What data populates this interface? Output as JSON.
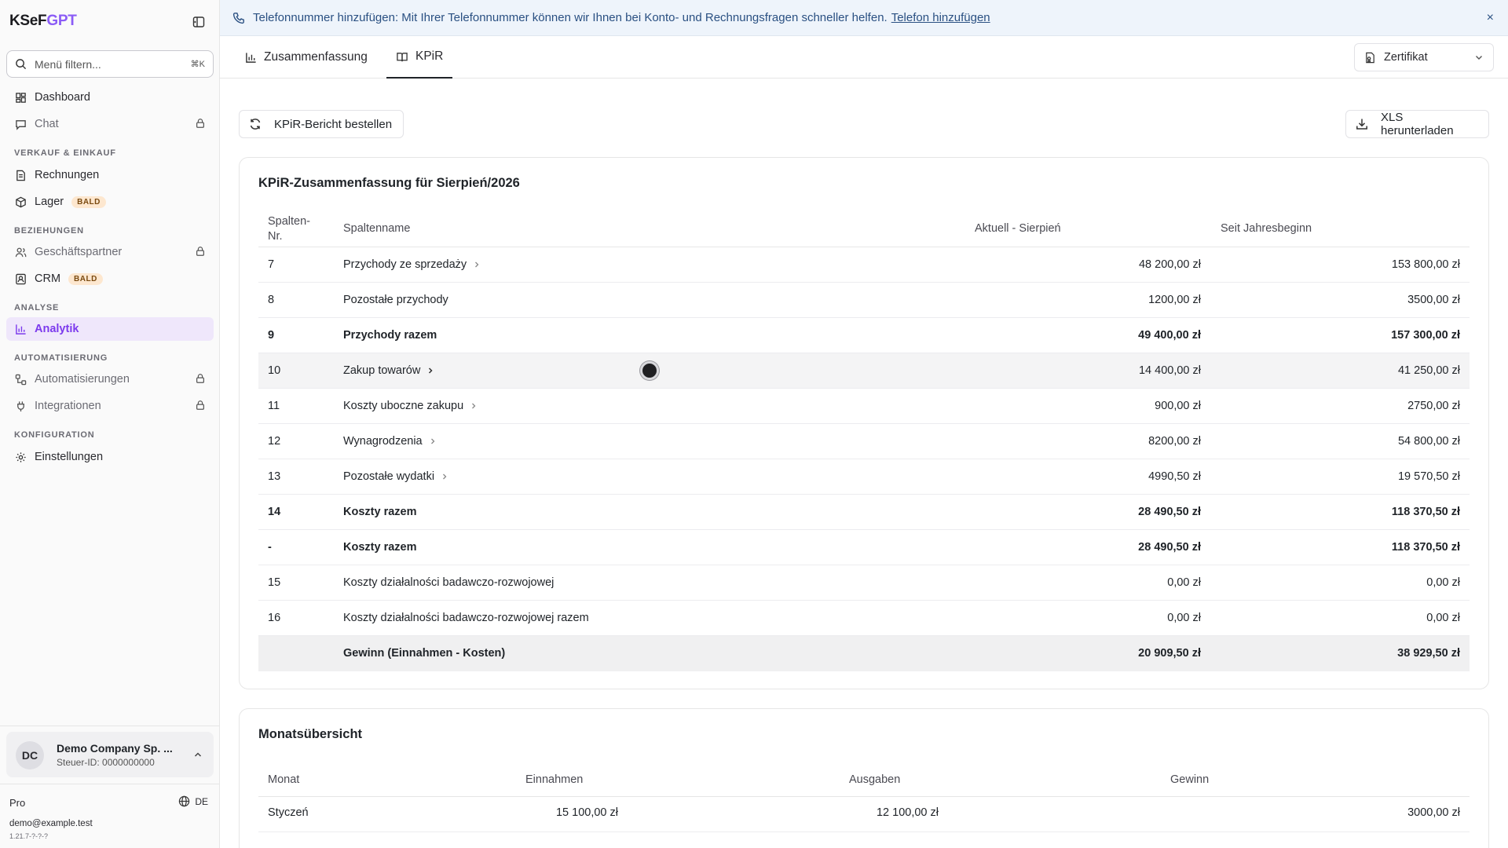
{
  "brand": {
    "prefix": "KSeF",
    "accent": "GPT"
  },
  "sidebar": {
    "filter_placeholder": "Menü filtern...",
    "filter_shortcut": "⌘K",
    "items": [
      {
        "label": "Dashboard"
      },
      {
        "label": "Chat"
      },
      {
        "label": "Rechnungen"
      },
      {
        "label": "Lager",
        "badge": "BALD"
      },
      {
        "label": "Geschäftspartner"
      },
      {
        "label": "CRM",
        "badge": "BALD"
      },
      {
        "label": "Analytik"
      },
      {
        "label": "Automatisierungen"
      },
      {
        "label": "Integrationen"
      },
      {
        "label": "Einstellungen"
      }
    ],
    "sections": [
      "VERKAUF & EINKAUF",
      "BEZIEHUNGEN",
      "ANALYSE",
      "AUTOMATISIERUNG",
      "KONFIGURATION"
    ],
    "account": {
      "initials": "DC",
      "name": "Demo Company Sp. ...",
      "tax_id": "Steuer-ID: 0000000000"
    },
    "plan": "Pro",
    "language": "DE",
    "email": "demo@example.test",
    "version": "1.21.7-?-?-?"
  },
  "banner": {
    "text": "Telefonnummer hinzufügen: Mit Ihrer Telefonnummer können wir Ihnen bei Konto- und Rechnungsfragen schneller helfen.",
    "link": "Telefon hinzufügen",
    "close": "×"
  },
  "tabs": [
    {
      "label": "Zusammenfassung"
    },
    {
      "label": "KPiR"
    }
  ],
  "certificate": {
    "label": "Zertifikat"
  },
  "actions": {
    "order_report": "KPiR-Bericht bestellen",
    "download_xls": "XLS herunterladen"
  },
  "kpir": {
    "title": "KPiR-Zusammenfassung für Sierpień/2026",
    "headers": {
      "nr_line1": "Spalten-",
      "nr_line2": "Nr.",
      "name": "Spaltenname",
      "current": "Aktuell - Sierpień",
      "ytd": "Seit Jahresbeginn"
    },
    "rows": [
      {
        "nr": "7",
        "name": "Przychody ze sprzedaży",
        "current": "48 200,00 zł",
        "ytd": "153 800,00 zł"
      },
      {
        "nr": "8",
        "name": "Pozostałe przychody",
        "current": "1200,00 zł",
        "ytd": "3500,00 zł"
      },
      {
        "nr": "9",
        "name": "Przychody razem",
        "current": "49 400,00 zł",
        "ytd": "157 300,00 zł"
      },
      {
        "nr": "10",
        "name": "Zakup towarów",
        "current": "14 400,00 zł",
        "ytd": "41 250,00 zł"
      },
      {
        "nr": "11",
        "name": "Koszty uboczne zakupu",
        "current": "900,00 zł",
        "ytd": "2750,00 zł"
      },
      {
        "nr": "12",
        "name": "Wynagrodzenia",
        "current": "8200,00 zł",
        "ytd": "54 800,00 zł"
      },
      {
        "nr": "13",
        "name": "Pozostałe wydatki",
        "current": "4990,50 zł",
        "ytd": "19 570,50 zł"
      },
      {
        "nr": "14",
        "name": "Koszty razem",
        "current": "28 490,50 zł",
        "ytd": "118 370,50 zł"
      },
      {
        "nr": "-",
        "name": "Koszty razem",
        "current": "28 490,50 zł",
        "ytd": "118 370,50 zł"
      },
      {
        "nr": "15",
        "name": "Koszty działalności badawczo-rozwojowej",
        "current": "0,00 zł",
        "ytd": "0,00 zł"
      },
      {
        "nr": "16",
        "name": "Koszty działalności badawczo-rozwojowej razem",
        "current": "0,00 zł",
        "ytd": "0,00 zł"
      },
      {
        "nr": "",
        "name": "Gewinn (Einnahmen - Kosten)",
        "current": "20 909,50 zł",
        "ytd": "38 929,50 zł"
      }
    ]
  },
  "monthly": {
    "title": "Monatsübersicht",
    "headers": {
      "month": "Monat",
      "income": "Einnahmen",
      "expenses": "Ausgaben",
      "profit": "Gewinn"
    },
    "rows": [
      {
        "month": "Styczeń",
        "income": "15 100,00 zł",
        "expenses": "12 100,00 zł",
        "profit": "3000,00 zł"
      }
    ]
  },
  "colors": {
    "accent": "#8b5cf6",
    "active_bg": "#efe7fb",
    "banner_bg": "#eef4fb",
    "badge_bg": "#fde7cf"
  }
}
